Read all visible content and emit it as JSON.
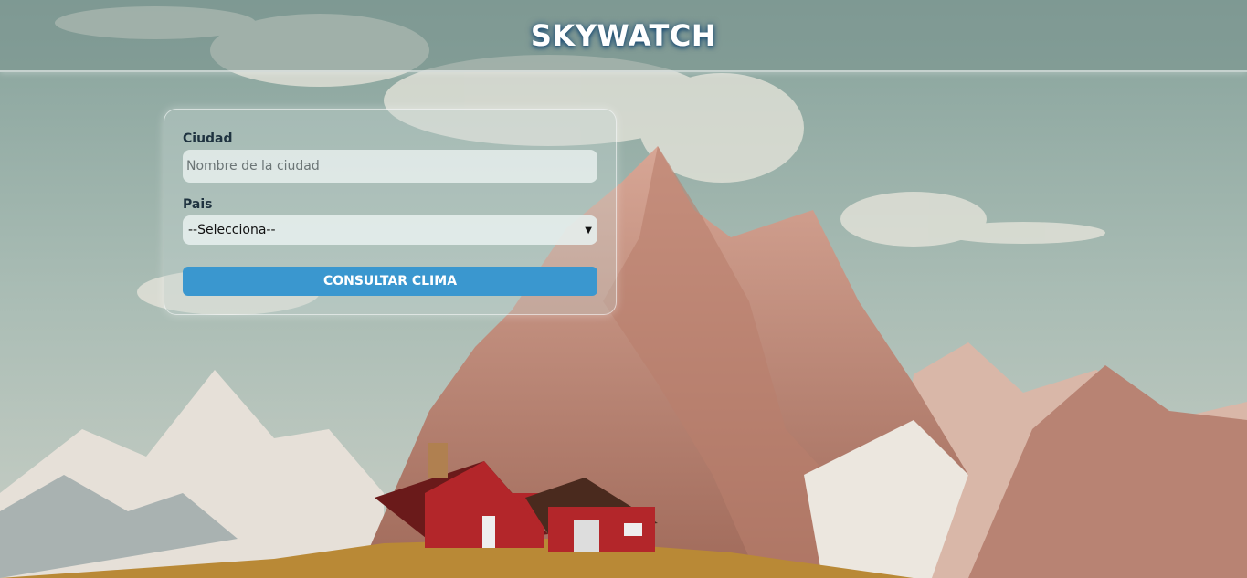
{
  "header": {
    "title": "SKYWATCH"
  },
  "form": {
    "city_label": "Ciudad",
    "city_placeholder": "Nombre de la ciudad",
    "city_value": "",
    "country_label": "Pais",
    "country_selected": "--Selecciona--",
    "submit_label": "CONSULTAR CLIMA"
  },
  "colors": {
    "accent": "#3a97cf",
    "header_bg": "#7a918c",
    "house": "#b3262a",
    "mountain": "#c48d7c"
  }
}
